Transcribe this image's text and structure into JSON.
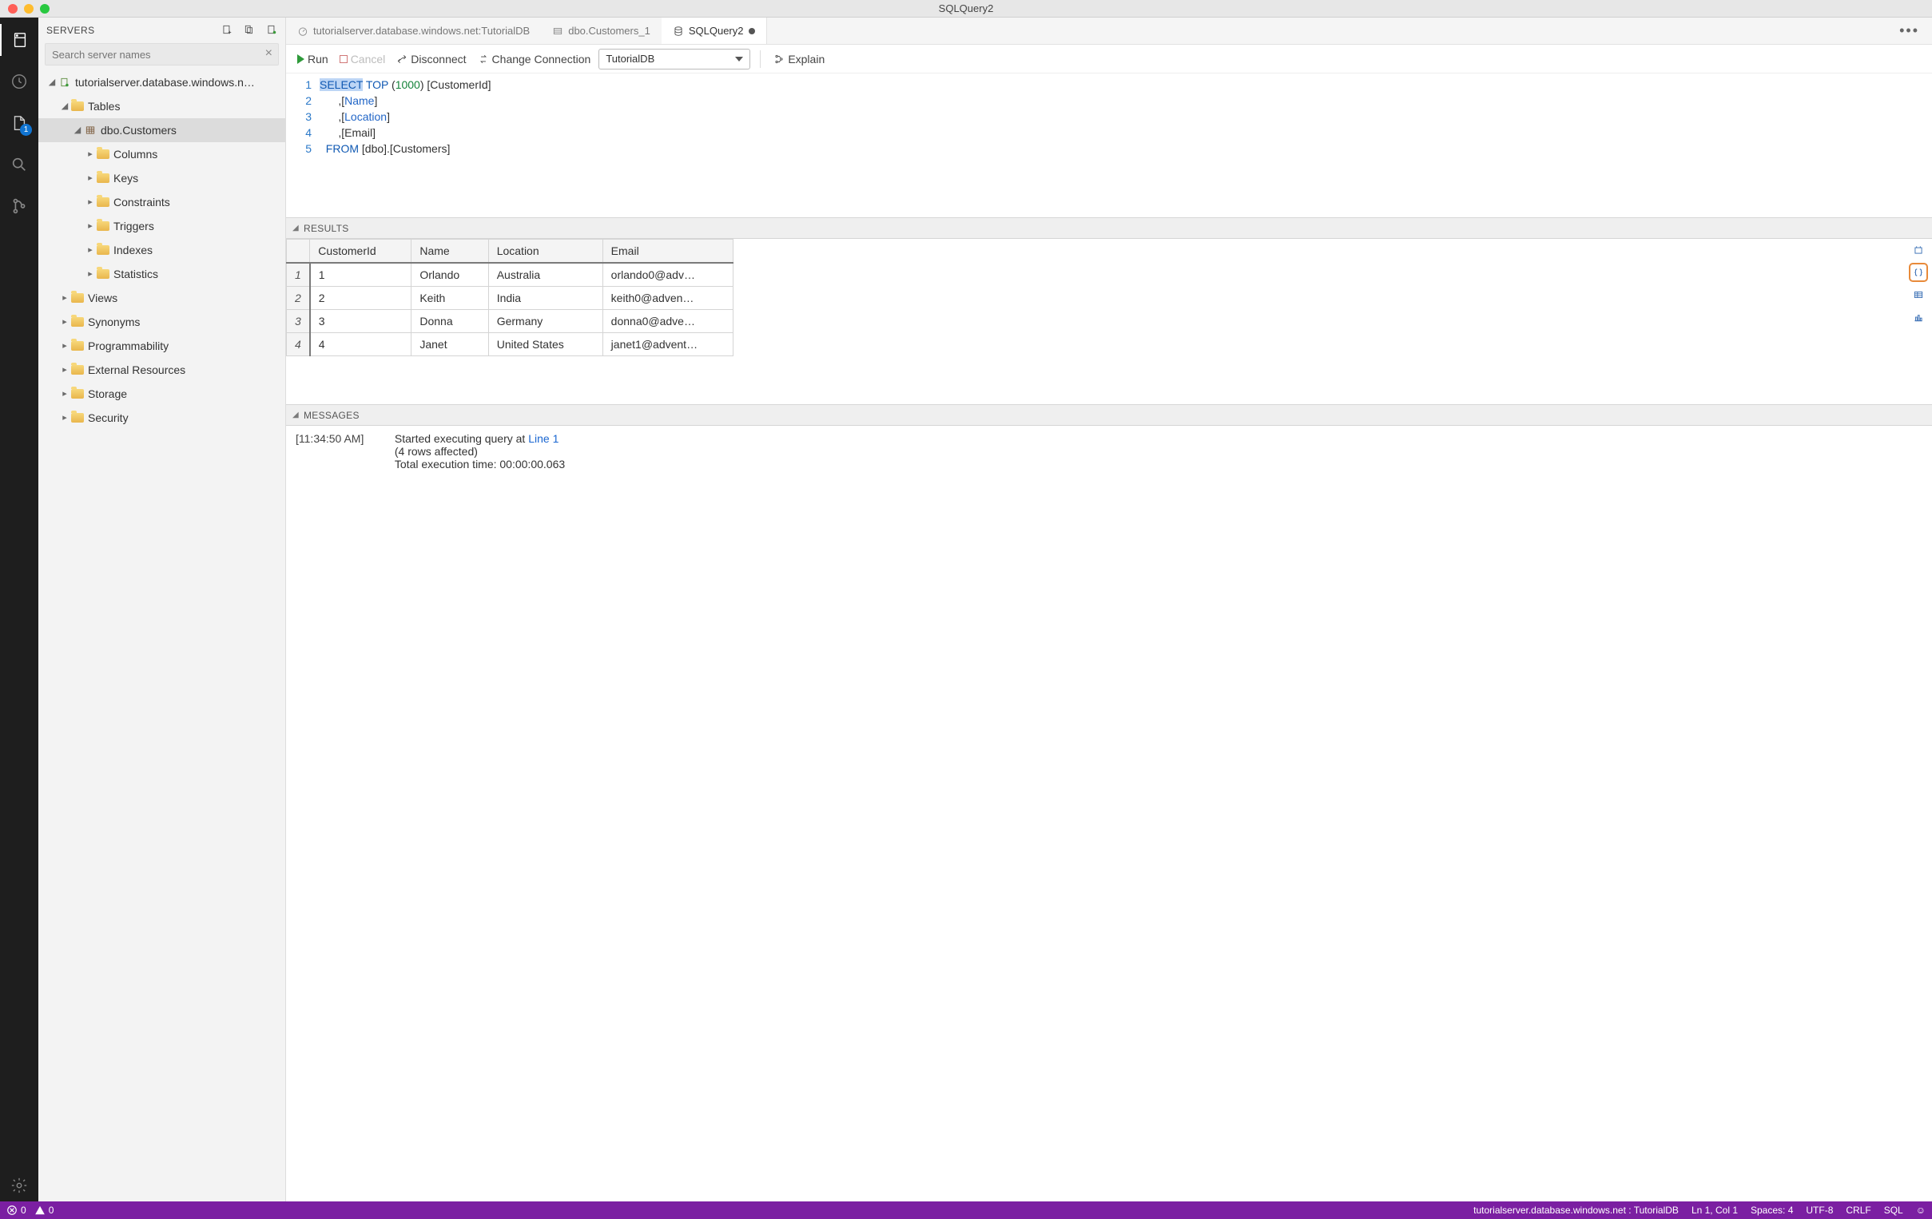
{
  "window": {
    "title": "SQLQuery2"
  },
  "activitybar": {
    "badge": "1"
  },
  "sidebar": {
    "title": "SERVERS",
    "search_placeholder": "Search server names",
    "server": "tutorialserver.database.windows.n…",
    "tables_label": "Tables",
    "table_node": "dbo.Customers",
    "table_children": [
      "Columns",
      "Keys",
      "Constraints",
      "Triggers",
      "Indexes",
      "Statistics"
    ],
    "db_children": [
      "Views",
      "Synonyms",
      "Programmability",
      "External Resources",
      "Storage",
      "Security"
    ]
  },
  "tabs": {
    "t0": "tutorialserver.database.windows.net:TutorialDB",
    "t1": "dbo.Customers_1",
    "t2": "SQLQuery2"
  },
  "toolbar": {
    "run": "Run",
    "cancel": "Cancel",
    "disconnect": "Disconnect",
    "change_conn": "Change Connection",
    "database": "TutorialDB",
    "explain": "Explain"
  },
  "editor": {
    "lines": {
      "l1_a": "SELECT",
      "l1_b": "TOP",
      "l1_c": "1000",
      "l1_d": "[CustomerId]",
      "l2_a": ",[",
      "l2_b": "Name",
      "l2_c": "]",
      "l3_a": ",[",
      "l3_b": "Location",
      "l3_c": "]",
      "l4": " ,[Email]",
      "l5_a": "FROM",
      "l5_b": "[dbo].[Customers]"
    }
  },
  "results": {
    "title": "RESULTS",
    "columns": [
      "CustomerId",
      "Name",
      "Location",
      "Email"
    ],
    "rows": [
      {
        "n": "1",
        "c0": "1",
        "c1": "Orlando",
        "c2": "Australia",
        "c3": "orlando0@adv…"
      },
      {
        "n": "2",
        "c0": "2",
        "c1": "Keith",
        "c2": "India",
        "c3": "keith0@adven…"
      },
      {
        "n": "3",
        "c0": "3",
        "c1": "Donna",
        "c2": "Germany",
        "c3": "donna0@adve…"
      },
      {
        "n": "4",
        "c0": "4",
        "c1": "Janet",
        "c2": "United States",
        "c3": "janet1@advent…"
      }
    ]
  },
  "messages": {
    "title": "MESSAGES",
    "timestamp": "[11:34:50 AM]",
    "m1a": "Started executing query at ",
    "m1b": "Line 1",
    "m2": "(4 rows affected)",
    "m3": "Total execution time: 00:00:00.063"
  },
  "status": {
    "errors": "0",
    "warnings": "0",
    "conn": "tutorialserver.database.windows.net : TutorialDB",
    "pos": "Ln 1, Col 1",
    "spaces": "Spaces: 4",
    "enc": "UTF-8",
    "eol": "CRLF",
    "lang": "SQL"
  }
}
